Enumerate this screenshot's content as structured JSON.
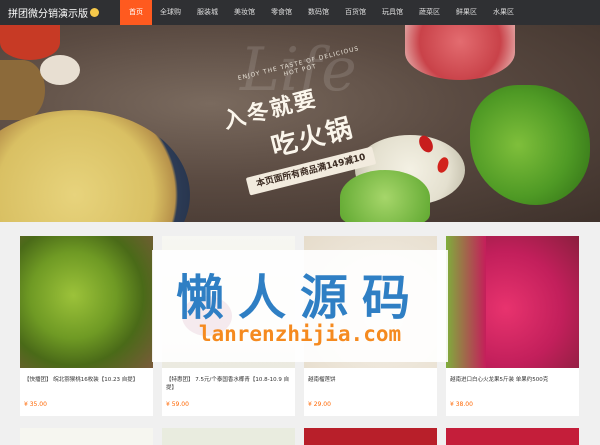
{
  "header": {
    "brand": "拼团微分销演示版",
    "brand_icon": "smiley-icon",
    "nav": [
      {
        "label": "首页",
        "active": true
      },
      {
        "label": "全球购"
      },
      {
        "label": "服装城"
      },
      {
        "label": "美妆馆"
      },
      {
        "label": "零食馆"
      },
      {
        "label": "数码馆"
      },
      {
        "label": "百货馆"
      },
      {
        "label": "玩具馆"
      },
      {
        "label": "蔬菜区"
      },
      {
        "label": "鲜果区"
      },
      {
        "label": "水果区"
      }
    ]
  },
  "banner": {
    "script_text": "Life",
    "arc_text": "ENJOY THE TASTE OF DELICIOUS HOT POT",
    "title_line1": "入冬就要",
    "title_line2": "吃火锅",
    "promo": "本页面所有商品满149减10"
  },
  "products": [
    {
      "desc": "【快播团】 皖北猕猴桃16枚装【10.23 自提】",
      "price": "¥ 35.00"
    },
    {
      "desc": "【特惠团】 7.5元/个泰国香水椰青【10.8-10.9 自提】",
      "price": "¥ 59.00"
    },
    {
      "desc": "越南榴莲饼",
      "price": "¥ 29.00"
    },
    {
      "desc": "越南进口白心火龙果5斤装 单果约500克",
      "price": "¥ 38.00"
    }
  ],
  "watermark": {
    "line1": "懒人源码",
    "line2": "lanrenzhijia.com"
  },
  "colors": {
    "topbar": "#2f3033",
    "nav_active": "#ff5a1f",
    "price": "#ff6600",
    "watermark_blue": "#2f7fc4",
    "watermark_orange": "#f58a1f"
  }
}
